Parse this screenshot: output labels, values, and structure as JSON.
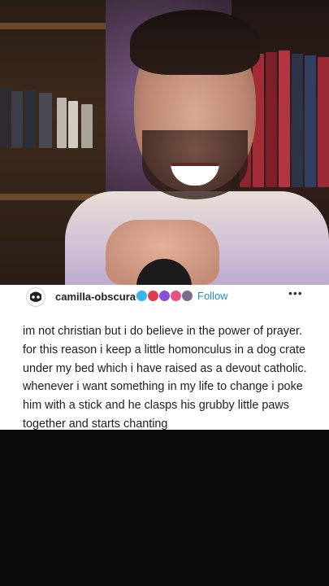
{
  "post": {
    "username": "camilla-obscura",
    "follow_label": "Follow",
    "more_label": "•••",
    "body": "im not christian but i do believe in the power of prayer. for this reason i keep a little homonculus in a dog crate under my bed which i have raised as a devout catholic. whenever i want something in my life to change i poke him with a stick and he clasps his grubby little paws together and starts chanting",
    "badges": [
      "blue-badge-icon",
      "red-badge-icon",
      "purple-badge-icon",
      "pink-badge-icon",
      "gray-badge-icon"
    ]
  },
  "colors": {
    "follow": "#1d8ccf",
    "card_bg": "#ffffff",
    "page_bg": "#0b0b0b"
  }
}
